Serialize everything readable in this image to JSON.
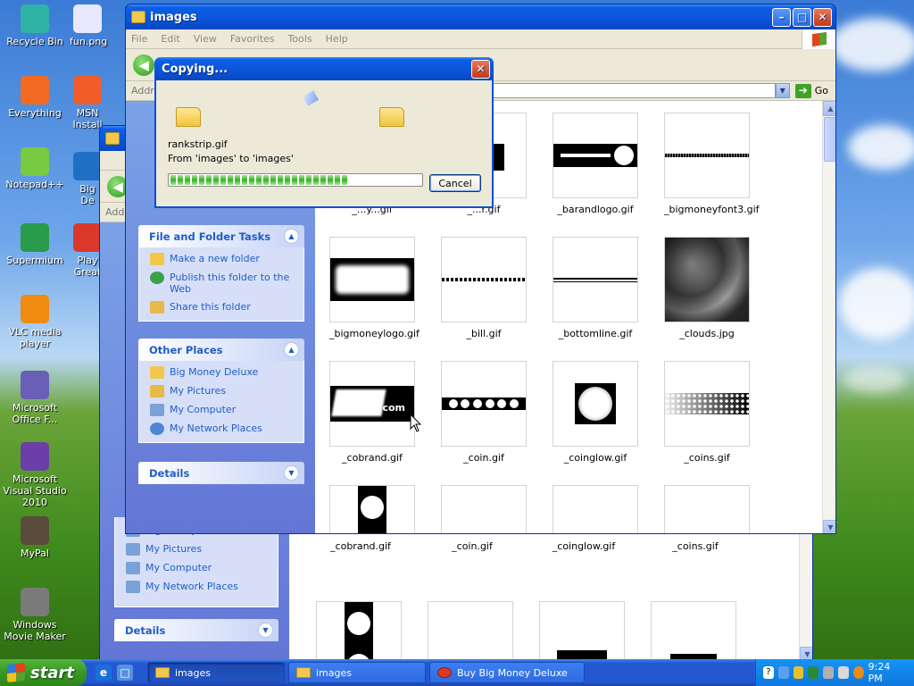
{
  "desktop": {
    "icons": [
      {
        "label": "Recycle Bin",
        "icon": "recycle-bin-icon",
        "color": "#2fb3a4"
      },
      {
        "label": "fun.png",
        "icon": "image-file-icon",
        "color": "#e8e8ff"
      },
      {
        "label": "Everything",
        "icon": "search-icon",
        "color": "#f26b21"
      },
      {
        "label": "MSN Install",
        "icon": "msn-butterfly-icon",
        "color": "#f15d2a"
      },
      {
        "label": "Notepad++",
        "icon": "notepad-icon",
        "color": "#7ac943"
      },
      {
        "label": "Big\nDe",
        "icon": "bmd-icon",
        "color": "#1f6fc4"
      },
      {
        "label": "Supermium",
        "icon": "browser-icon",
        "color": "#2a9a4b"
      },
      {
        "label": "Play\nGreat",
        "icon": "play-icon",
        "color": "#d9382a"
      },
      {
        "label": "VLC media player",
        "icon": "vlc-cone-icon",
        "color": "#f08a10"
      },
      {
        "label": "Microsoft Office F...",
        "icon": "office-icon",
        "color": "#6a5fb6"
      },
      {
        "label": "Microsoft Visual Studio 2010",
        "icon": "visual-studio-icon",
        "color": "#6c3fa8"
      },
      {
        "label": "MyPal",
        "icon": "raccoon-icon",
        "color": "#5a4a3a"
      },
      {
        "label": "Windows Movie Maker",
        "icon": "film-reel-icon",
        "color": "#7a7a7a"
      }
    ]
  },
  "back_window": {
    "task_links": [
      "Big Money Deluxe",
      "My Pictures",
      "My Computer",
      "My Network Places"
    ],
    "details_label": "Details",
    "captions": [
      "_cobrand.gif",
      "_coin.gif",
      "_coinglow.gif",
      "_coins.gif"
    ]
  },
  "front_window": {
    "title": "images",
    "menu": [
      "File",
      "Edit",
      "View",
      "Favorites",
      "Tools",
      "Help"
    ],
    "address_label": "Addre",
    "go_label": "Go",
    "file_folder_tasks": {
      "title": "File and Folder Tasks",
      "links": [
        "Make a new folder",
        "Publish this folder to the Web",
        "Share this folder"
      ]
    },
    "other_places": {
      "title": "Other Places",
      "links": [
        "Big Money Deluxe",
        "My Pictures",
        "My Computer",
        "My Network Places"
      ]
    },
    "details": {
      "title": "Details"
    },
    "files": [
      {
        "name": "_...y...gif",
        "kind": "partial-a"
      },
      {
        "name": "_...r.gif",
        "kind": "partial-b"
      },
      {
        "name": "_barandlogo.gif",
        "kind": "barandlogo"
      },
      {
        "name": "_bigmoneyfont3.gif",
        "kind": "thinline"
      },
      {
        "name": "_bigmoneylogo.gif",
        "kind": "bigmoneylogo"
      },
      {
        "name": "_bill.gif",
        "kind": "bill"
      },
      {
        "name": "_bottomline.gif",
        "kind": "bottomline"
      },
      {
        "name": "_clouds.jpg",
        "kind": "clouds"
      },
      {
        "name": "_cobrand.gif",
        "kind": "cobrand"
      },
      {
        "name": "_coin.gif",
        "kind": "coin"
      },
      {
        "name": "_coinglow.gif",
        "kind": "coinglow"
      },
      {
        "name": "_coins.gif",
        "kind": "coins"
      }
    ]
  },
  "copy_dialog": {
    "title": "Copying...",
    "filename": "rankstrip.gif",
    "from_to": "From 'images' to 'images'",
    "cancel_label": "Cancel",
    "progress_fraction": 0.72
  },
  "taskbar": {
    "start_label": "start",
    "items": [
      {
        "label": "images",
        "active": true
      },
      {
        "label": "images",
        "active": false
      },
      {
        "label": "Buy Big Money Deluxe",
        "active": false
      }
    ],
    "clock": "9:24 PM"
  }
}
